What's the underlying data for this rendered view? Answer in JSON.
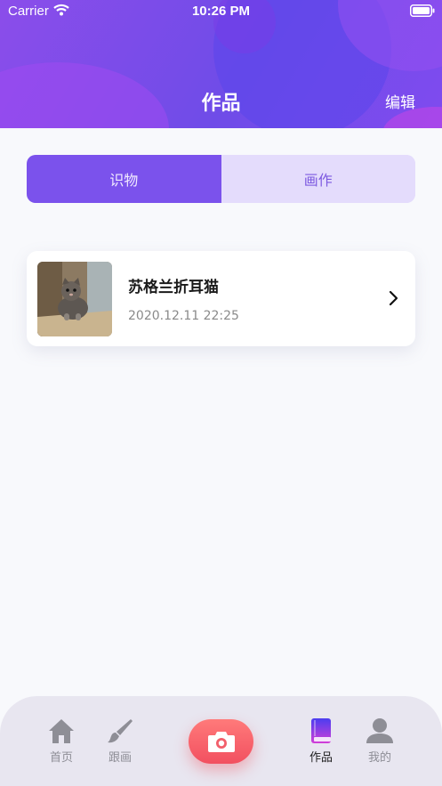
{
  "status_bar": {
    "carrier": "Carrier",
    "time": "10:26 PM"
  },
  "nav": {
    "title": "作品",
    "edit_label": "编辑"
  },
  "segments": [
    {
      "label": "识物",
      "active": true
    },
    {
      "label": "画作",
      "active": false
    }
  ],
  "works": [
    {
      "title": "苏格兰折耳猫",
      "date": "2020.12.11 22:25",
      "thumbnail_icon": "cat-photo"
    }
  ],
  "tab_bar": {
    "items": [
      {
        "label": "首页",
        "icon": "home-icon",
        "active": false
      },
      {
        "label": "跟画",
        "icon": "brush-icon",
        "active": false
      },
      {
        "label": "作品",
        "icon": "book-icon",
        "active": true
      },
      {
        "label": "我的",
        "icon": "person-icon",
        "active": false
      }
    ],
    "center_action_icon": "camera-icon"
  },
  "colors": {
    "accent": "#7b52ec",
    "segment_inactive_bg": "#e4dcfc",
    "camera_button": "#f25060"
  }
}
